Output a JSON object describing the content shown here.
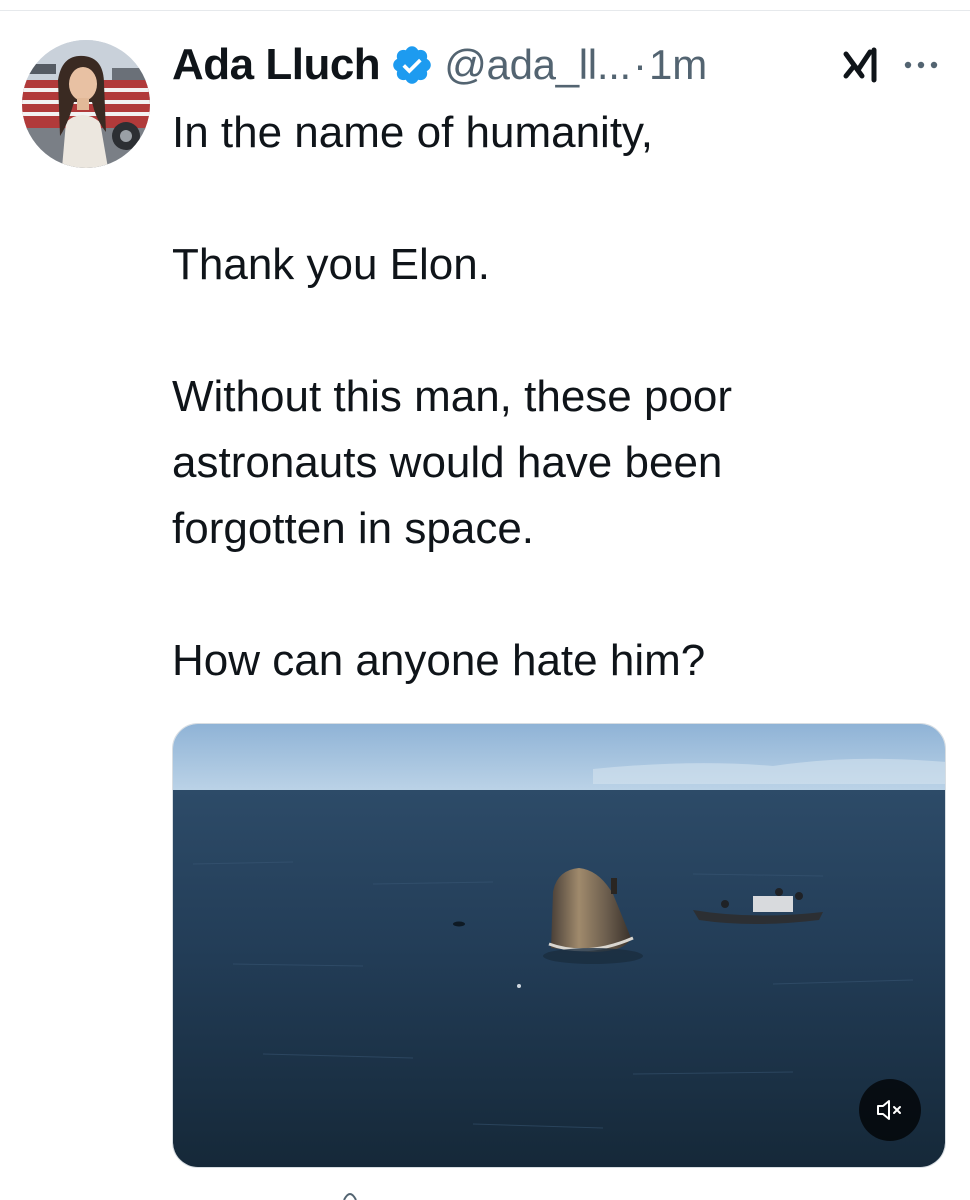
{
  "tweet": {
    "author": {
      "display_name": "Ada Lluch",
      "handle": "@ada_ll...",
      "verified": true,
      "avatar_icon": "profile-photo"
    },
    "separator": "·",
    "timestamp": "1m",
    "text_lines": [
      "In the name of humanity,",
      "Thank you Elon.",
      "Without this man, these poor astronauts would have been forgotten in space.",
      "How can anyone hate him?"
    ],
    "media": {
      "type": "video",
      "icon": "mute-icon",
      "muted": true
    },
    "actions": {
      "grok_icon": "grok-icon",
      "more_icon": "more-options-icon"
    }
  },
  "colors": {
    "text_primary": "#0f1419",
    "text_secondary": "#536471",
    "verified_blue": "#1d9bf0",
    "divider": "#e6e9ec"
  }
}
